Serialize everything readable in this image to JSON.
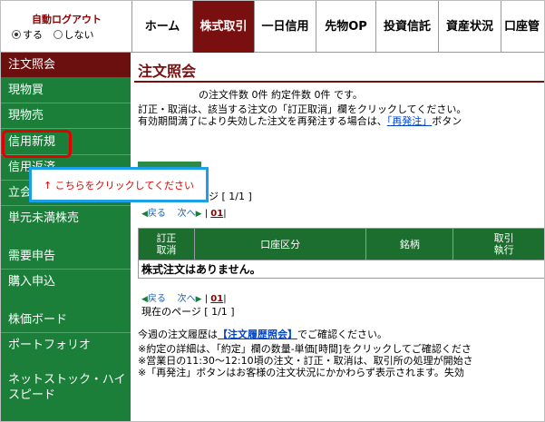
{
  "logout": {
    "title": "自動ログアウト",
    "option_on": "する",
    "option_off": "しない",
    "selected": "する"
  },
  "topnav": {
    "tabs": [
      "ホーム",
      "株式取引",
      "一日信用",
      "先物OP",
      "投資信託",
      "資産状況",
      "口座管"
    ],
    "active": "株式取引"
  },
  "sidebar": {
    "items": [
      "注文照会",
      "現物買",
      "現物売",
      "信用新規",
      "信用返済",
      "立会",
      "単元未満株売",
      "需要申告",
      "購入申込",
      "株価ボード",
      "ポートフォリオ",
      "ネットストック・ハイスピード"
    ],
    "active": "注文照会",
    "highlighted": "信用新規"
  },
  "callout": {
    "text": "↑ こちらをクリックしてください"
  },
  "main": {
    "title": "注文照会",
    "count_line": "の注文件数 0件 約定件数 0件 です。",
    "instruction1": "訂正・取消は、該当する注文の「訂正取消」欄をクリックしてください。",
    "instruction2_pre": "有効期間満了により失効した注文を再発注する場合は、",
    "instruction2_link": "「再発注」",
    "instruction2_post": "ボタン",
    "page_top_partial": "ジ [ 1/1 ]",
    "page_bottom": "現在のページ [ 1/1 ]",
    "pager": {
      "prev": "戻る",
      "next": "次へ",
      "page": "01"
    },
    "table": {
      "headers": [
        "訂正\n取消",
        "口座区分",
        "銘柄",
        "取引\n執行"
      ],
      "empty_message": "株式注文はありません。"
    },
    "history_pre": "今週の注文履歴は",
    "history_link": "【注文履歴照会】",
    "history_post": "でご確認ください。",
    "note1": "※約定の詳細は、「約定」欄の数量-単価[時間]をクリックしてご確認くださ",
    "note2": "※営業日の11:30～12:10頃の注文・訂正・取消は、取引所の処理が開始さ",
    "note3": "※「再発注」ボタンはお客様の注文状況にかかわらず表示されます。失効"
  },
  "colors": {
    "sidebar_green": "#1b7f3a",
    "active_maroon": "#7a0f0f",
    "header_green": "#1b6e2e",
    "highlight_red": "#e30000",
    "callout_blue": "#1aa0e8",
    "link_blue": "#0044cc"
  }
}
